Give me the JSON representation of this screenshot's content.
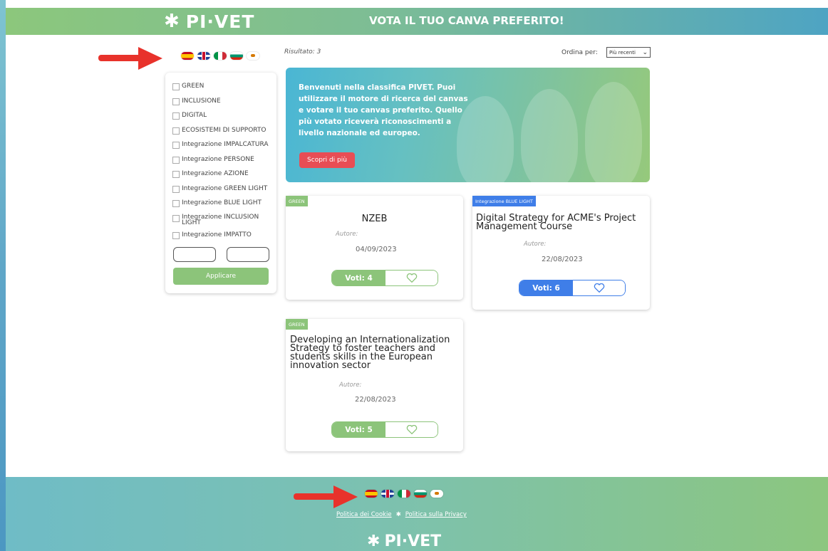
{
  "header": {
    "logo_text": "PI·VET",
    "title": "VOTA IL TUO CANVA PREFERITO!"
  },
  "flags": [
    "es",
    "gb",
    "it",
    "bg",
    "cy"
  ],
  "sidebar": {
    "filters": [
      {
        "label": "GREEN"
      },
      {
        "label": "INCLUSIONE"
      },
      {
        "label": "DIGITAL"
      },
      {
        "label": "ECOSISTEMI DI SUPPORTO"
      },
      {
        "label": "Integrazione IMPALCATURA"
      },
      {
        "label": "Integrazione PERSONE"
      },
      {
        "label": "Integrazione AZIONE"
      },
      {
        "label": "Integrazione GREEN LIGHT"
      },
      {
        "label": "Integrazione BLUE LIGHT"
      },
      {
        "label": "Integrazione INCLUSION LIGHT"
      },
      {
        "label": "Integrazione IMPATTO"
      }
    ],
    "apply_label": "Applicare"
  },
  "results": {
    "label": "Risultato: 3"
  },
  "sort": {
    "label": "Ordina per:",
    "selected": "Più recenti"
  },
  "banner": {
    "text": "Benvenuti nella classifica PIVET. Puoi utilizzare il motore di ricerca del canvas e votare il tuo canvas preferito. Quello più votato riceverà riconoscimenti a livello nazionale ed europeo.",
    "button": "Scopri di più"
  },
  "cards": [
    {
      "tag": "GREEN",
      "title": "NZEB",
      "author": "Autore:",
      "date": "04/09/2023",
      "votes": "Voti: 4"
    },
    {
      "tag": "Integrazione BLUE LIGHT",
      "title": "Digital Strategy for ACME's Project Management Course",
      "author": "Autore:",
      "date": "22/08/2023",
      "votes": "Voti: 6"
    },
    {
      "tag": "GREEN",
      "title": "Developing an Internationalization Strategy to foster teachers and students skills in the European innovation sector",
      "author": "Autore:",
      "date": "22/08/2023",
      "votes": "Voti: 5"
    }
  ],
  "footer": {
    "cookie_link": "Politica dei Cookie",
    "privacy_link": "Politica sulla Privacy",
    "logo_text": "PI·VET"
  },
  "colors": {
    "green": "#8cc47a",
    "blue": "#3f7ee8",
    "red_button": "#e84d55",
    "arrow_red": "#e8322b"
  }
}
